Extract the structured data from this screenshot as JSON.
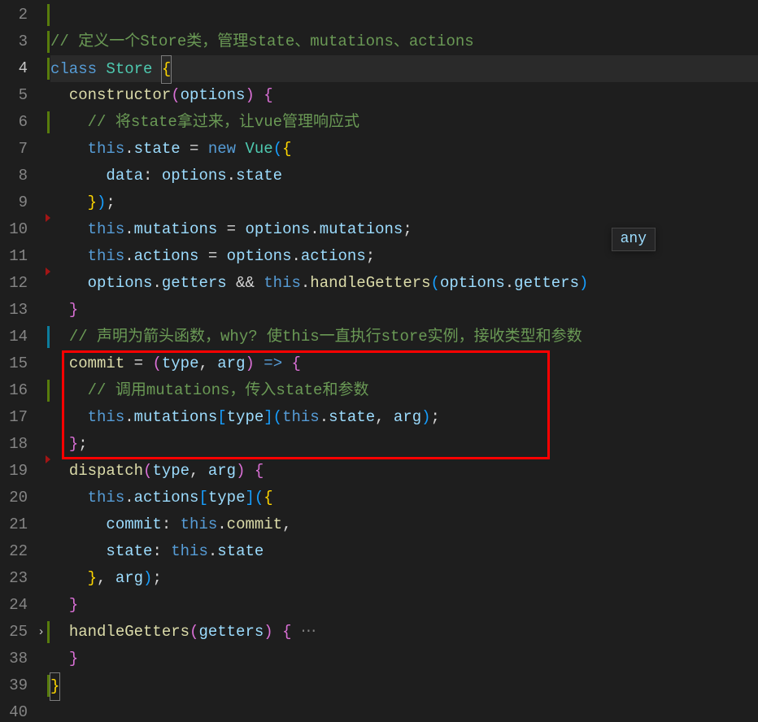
{
  "hover": {
    "text": "any"
  },
  "gutter": {
    "lines": [
      "2",
      "3",
      "4",
      "5",
      "6",
      "7",
      "8",
      "9",
      "10",
      "11",
      "12",
      "13",
      "14",
      "15",
      "16",
      "17",
      "18",
      "19",
      "20",
      "21",
      "22",
      "23",
      "24",
      "25",
      "38",
      "39",
      "40"
    ],
    "active_index": 2,
    "fold_chevron_index": 23
  },
  "code": {
    "l2": "",
    "l3_comment": "// 定义一个Store类，管理state、mutations、actions",
    "l4_class": "class",
    "l4_name": " Store ",
    "l4_ob": "{",
    "l5_ctor": "constructor",
    "l5_op": "(",
    "l5_arg": "options",
    "l5_cp": ") ",
    "l5_ob": "{",
    "l6_comment": "// 将state拿过来，让vue管理响应式",
    "l7_this": "this",
    "l7_dot": ".",
    "l7_state": "state",
    "l7_eq": " = ",
    "l7_new": "new",
    "l7_sp": " ",
    "l7_vue": "Vue",
    "l7_op": "(",
    "l7_ob": "{",
    "l8_data": "data",
    "l8_colon": ": ",
    "l8_opts": "options",
    "l8_dot": ".",
    "l8_state": "state",
    "l9_cb": "}",
    "l9_cp": ")",
    "l9_sc": ";",
    "l10_this": "this",
    "l10_dot": ".",
    "l10_mut": "mutations",
    "l10_eq": " = ",
    "l10_opts": "options",
    "l10_dot2": ".",
    "l10_mut2": "mutations",
    "l10_sc": ";",
    "l11_this": "this",
    "l11_dot": ".",
    "l11_act": "actions",
    "l11_eq": " = ",
    "l11_opts": "options",
    "l11_dot2": ".",
    "l11_act2": "actions",
    "l11_sc": ";",
    "l12_opts": "options",
    "l12_dot": ".",
    "l12_get": "getters",
    "l12_and": " && ",
    "l12_this": "this",
    "l12_dot2": ".",
    "l12_fn": "handleGetters",
    "l12_op": "(",
    "l12_opts2": "options",
    "l12_dot3": ".",
    "l12_get2": "getters",
    "l12_cp": ")",
    "l13_cb": "}",
    "l14_comment": "// 声明为箭头函数，why? 使this一直执行store实例，接收类型和参数",
    "l15_commit": "commit",
    "l15_eq": " = ",
    "l15_op": "(",
    "l15_type": "type",
    "l15_comma": ", ",
    "l15_arg": "arg",
    "l15_cp": ")",
    "l15_arrow": " => ",
    "l15_ob": "{",
    "l16_comment": "// 调用mutations，传入state和参数",
    "l17_this": "this",
    "l17_dot": ".",
    "l17_mut": "mutations",
    "l17_ob": "[",
    "l17_type": "type",
    "l17_cb": "]",
    "l17_op": "(",
    "l17_this2": "this",
    "l17_dot2": ".",
    "l17_state": "state",
    "l17_comma": ", ",
    "l17_arg": "arg",
    "l17_cp": ")",
    "l17_sc": ";",
    "l18_cb": "}",
    "l18_sc": ";",
    "l19_disp": "dispatch",
    "l19_op": "(",
    "l19_type": "type",
    "l19_comma": ", ",
    "l19_arg": "arg",
    "l19_cp": ") ",
    "l19_ob": "{",
    "l20_this": "this",
    "l20_dot": ".",
    "l20_act": "actions",
    "l20_ob": "[",
    "l20_type": "type",
    "l20_cb": "]",
    "l20_op": "(",
    "l20_ob2": "{",
    "l21_commit": "commit",
    "l21_colon": ": ",
    "l21_this": "this",
    "l21_dot": ".",
    "l21_commit2": "commit",
    "l21_comma": ",",
    "l22_state": "state",
    "l22_colon": ": ",
    "l22_this": "this",
    "l22_dot": ".",
    "l22_state2": "state",
    "l23_cb": "}",
    "l23_comma": ", ",
    "l23_arg": "arg",
    "l23_cp": ")",
    "l23_sc": ";",
    "l24_cb": "}",
    "l25_fn": "handleGetters",
    "l25_op": "(",
    "l25_arg": "getters",
    "l25_cp": ") ",
    "l25_ob": "{",
    "l25_dots": " ⋯",
    "l38_cb": "}",
    "l39_cb": "}",
    "l40": ""
  }
}
